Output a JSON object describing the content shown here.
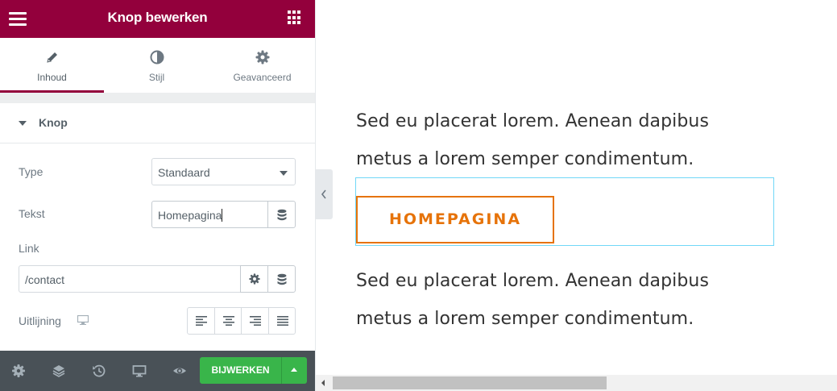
{
  "header": {
    "title": "Knop bewerken",
    "menu_icon": "hamburger-icon",
    "apps_icon": "grid-icon",
    "color": "#93003c"
  },
  "tabs": [
    {
      "label": "Inhoud",
      "icon": "pencil-icon",
      "active": true
    },
    {
      "label": "Stijl",
      "icon": "contrast-icon",
      "active": false
    },
    {
      "label": "Geavanceerd",
      "icon": "gear-icon",
      "active": false
    }
  ],
  "section": {
    "label": "Knop",
    "expanded": true
  },
  "controls": {
    "type": {
      "label": "Type",
      "value": "Standaard"
    },
    "text": {
      "label": "Tekst",
      "value": "Homepagina"
    },
    "link": {
      "label": "Link",
      "value": "/contact"
    },
    "alignment": {
      "label": "Uitlijning",
      "device_icon": "desktop-icon",
      "options": [
        "left",
        "center",
        "right",
        "justify"
      ]
    }
  },
  "footer": {
    "icons": [
      "settings-icon",
      "layers-icon",
      "history-icon",
      "responsive-icon",
      "preview-eye-icon"
    ],
    "publish_label": "BIJWERKEN",
    "publish_color": "#39b54a"
  },
  "preview": {
    "paragraph_top": [
      "Sed eu placerat lorem. Aenean dapibus",
      "metus a lorem semper condimentum."
    ],
    "button_label": "HOMEPAGINA",
    "button_color": "#e6730a",
    "paragraph_bottom": [
      "Sed eu placerat lorem. Aenean dapibus",
      "metus a lorem semper condimentum."
    ]
  }
}
